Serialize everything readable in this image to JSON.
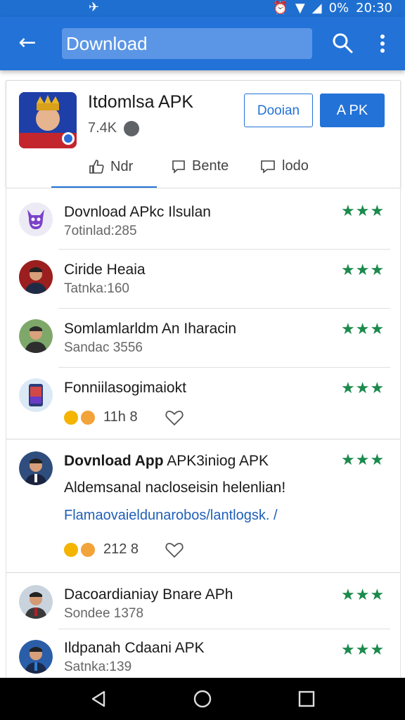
{
  "status_bar": {
    "battery": "0%",
    "time": "20:30"
  },
  "app_bar": {
    "title": "Download"
  },
  "app_card": {
    "title": "Itdomlsa APK",
    "subtitle": "7.4K",
    "outline_button": "Dooian",
    "fill_button": "A PK",
    "tabs": [
      {
        "label": "Ndr"
      },
      {
        "label": "Bente"
      },
      {
        "label": "lodo"
      }
    ]
  },
  "list": [
    {
      "title": "Dovnload APkc Ilsulan",
      "subtitle": "7otinlad:285",
      "stars": "★★★"
    },
    {
      "title": "Ciride Heaia",
      "subtitle": "Tatnka:160",
      "stars": "★★★"
    },
    {
      "title": "Somlamlarldm An Iharacin",
      "subtitle": "Sandac 3556",
      "stars": "★★★"
    },
    {
      "title": "Fonniilasogimaiokt",
      "subtitle": "",
      "count": "11h 8",
      "stars": "★★★"
    },
    {
      "title_bold": "Dovnload App",
      "title_rest": " APK3iniog APK",
      "body": "Aldemsanal nacloseisin helenlian!",
      "link": "Flamaovaieldunarobos/lantlogsk. /",
      "count": "212 8",
      "stars": "★★★"
    },
    {
      "title": "Dacoardianiay Bnare APh",
      "subtitle": "Sondee 1378",
      "stars": "★★★"
    },
    {
      "title": "Ildpanah Cdaani APK",
      "subtitle": "Satnka:139",
      "stars": "★★★"
    }
  ],
  "colors": {
    "primary": "#2372d8",
    "star": "#1b8a4c"
  }
}
